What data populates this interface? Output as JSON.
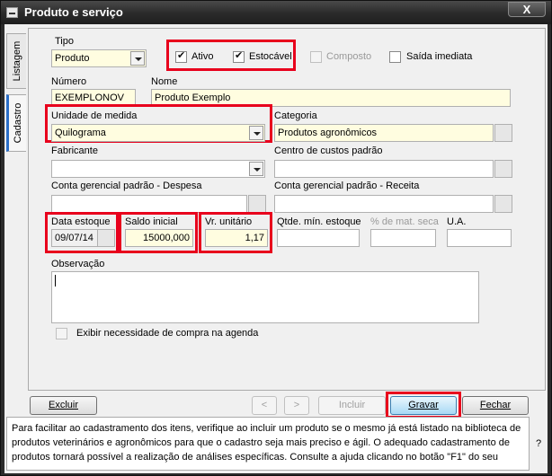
{
  "window": {
    "title": "Produto e serviço",
    "close": "X"
  },
  "tabs": [
    "Listagem",
    "Cadastro"
  ],
  "form": {
    "tipo_label": "Tipo",
    "tipo_value": "Produto",
    "ativo_label": "Ativo",
    "ativo_checked": true,
    "estocavel_label": "Estocável",
    "estocavel_checked": true,
    "composto_label": "Composto",
    "saida_label": "Saída imediata",
    "numero_label": "Número",
    "numero_value": "EXEMPLONOV",
    "nome_label": "Nome",
    "nome_value": "Produto Exemplo",
    "unidade_label": "Unidade de medida",
    "unidade_value": "Quilograma",
    "categoria_label": "Categoria",
    "categoria_value": "Produtos agronômicos",
    "fabricante_label": "Fabricante",
    "centro_label": "Centro de custos padrão",
    "conta_despesa_label": "Conta gerencial padrão - Despesa",
    "conta_receita_label": "Conta gerencial padrão - Receita",
    "data_estoque_label": "Data estoque",
    "data_estoque_value": "09/07/14",
    "saldo_label": "Saldo inicial",
    "saldo_value": "15000,000",
    "vr_label": "Vr. unitário",
    "vr_value": "1,17",
    "qtde_label": "Qtde. mín. estoque",
    "pct_label": "% de mat. seca",
    "ua_label": "U.A.",
    "obs_label": "Observação",
    "exibir_label": "Exibir necessidade de compra na agenda"
  },
  "buttons": {
    "excluir": "Excluir",
    "prev": "<",
    "next": ">",
    "incluir": "Incluir",
    "gravar": "Gravar",
    "fechar": "Fechar"
  },
  "help": {
    "text": "Para facilitar ao cadastramento dos itens, verifique ao incluir um produto se o mesmo já está listado na biblioteca de produtos veterinários e agronômicos para que o cadastro seja mais preciso e ágil. O adequado cadastramento de produtos tornará possível a realização de análises específicas. Consulte a ajuda clicando no botão \"F1\" do seu",
    "question": "?"
  },
  "colors": {
    "highlight": "#e8001c",
    "required_field": "#fffde0",
    "title_bar": "#2c2c2c"
  }
}
